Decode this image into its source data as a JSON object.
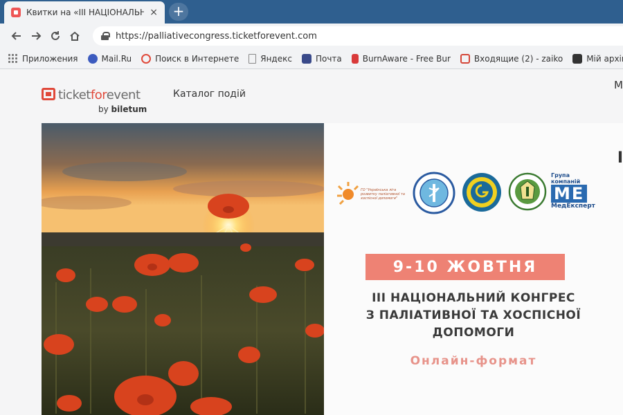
{
  "browser": {
    "tab_title": "Квитки на «III НАЦІОНАЛЬНИЙ",
    "tab_close": "×",
    "new_tab": "+",
    "url": "https://palliativecongress.ticketforevent.com"
  },
  "bookmarks": [
    {
      "label": "Приложения",
      "icon": "apps-icon",
      "color": "#777777"
    },
    {
      "label": "Mail.Ru",
      "icon": "mailru-icon",
      "color": "#3c5bbf"
    },
    {
      "label": "Поиск в Интернете",
      "icon": "search-icon",
      "color": "#e0493a"
    },
    {
      "label": "Яндекс",
      "icon": "page-icon",
      "color": "#888888"
    },
    {
      "label": "Почта",
      "icon": "mail-icon",
      "color": "#3a4a8a"
    },
    {
      "label": "BurnAware - Free Bur",
      "icon": "burnaware-icon",
      "color": "#d93a3a"
    },
    {
      "label": "Входящие (2) - zaiko",
      "icon": "gmail-icon",
      "color": "#d44638"
    },
    {
      "label": "Мій архів ел",
      "icon": "archive-icon",
      "color": "#333333"
    }
  ],
  "site": {
    "logo": {
      "part1": "ticket",
      "part2": "for",
      "part3": "event",
      "by": "by",
      "brand": "biletum"
    },
    "menu_link": "Каталог подій",
    "edge_letter": "M",
    "edge_letter2": "I"
  },
  "banner": {
    "partners": {
      "pal_text": "ГО \"Українська ліга розвитку паліативної та хоспісної допомоги\"",
      "medexpert_group": "Група компаній",
      "medexpert_logo": "МЕ",
      "medexpert_name": "МедЕксперт"
    },
    "date": "9-10 ЖОВТНЯ",
    "title_lines": [
      "III НАЦІОНАЛЬНИЙ КОНГРЕС",
      "З ПАЛІАТИВНОЇ ТА ХОСПІСНОЇ",
      "ДОПОМОГИ"
    ],
    "format": "Онлайн-формат"
  },
  "colors": {
    "accent": "#ee8274",
    "brand_red": "#e0493a",
    "tabstrip": "#2f5f8f"
  }
}
